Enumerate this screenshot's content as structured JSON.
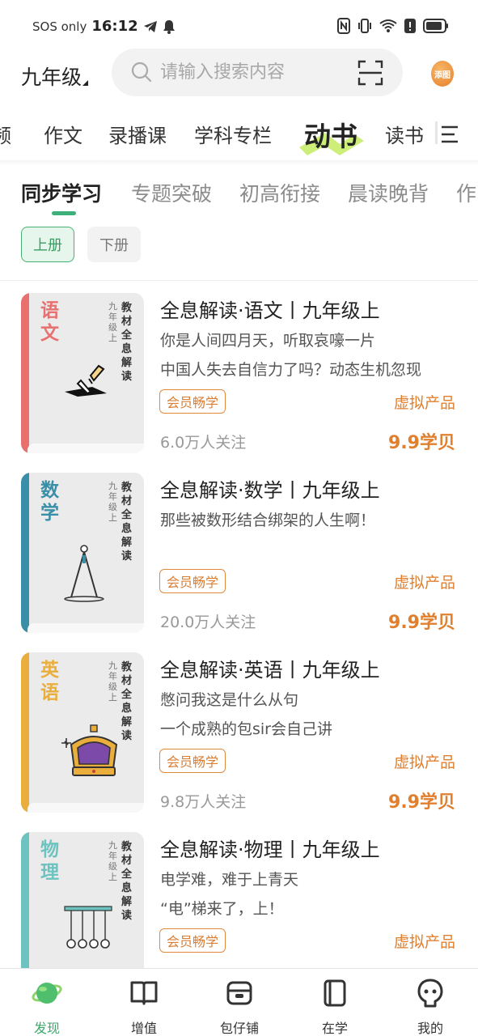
{
  "status_bar": {
    "carrier": "SOS only",
    "time": "16:12"
  },
  "header": {
    "grade": "九年级",
    "search_placeholder": "请输入搜索内容",
    "avatar_text": "添图"
  },
  "category_tabs": [
    {
      "label": "频",
      "active": false
    },
    {
      "label": "作文",
      "active": false
    },
    {
      "label": "录播课",
      "active": false
    },
    {
      "label": "学科专栏",
      "active": false
    },
    {
      "label": "动书",
      "active": true
    },
    {
      "label": "读书",
      "active": false
    }
  ],
  "sub_tabs": [
    {
      "label": "同步学习",
      "active": true
    },
    {
      "label": "专题突破",
      "active": false
    },
    {
      "label": "初高衔接",
      "active": false
    },
    {
      "label": "晨读晚背",
      "active": false
    },
    {
      "label": "作",
      "active": false
    }
  ],
  "volume": {
    "up": "上册",
    "down": "下册",
    "selected": "上册"
  },
  "cover_common": {
    "grade_vertical": "九年级上",
    "series_vertical": "教材全息解读"
  },
  "products": [
    {
      "subject": "语文",
      "subject_color": "#e8706e",
      "title": "全息解读·语文丨九年级上",
      "lines": [
        "你是人间四月天，听取哀嚎一片",
        "中国人失去自信力了吗？动态生机忽现"
      ],
      "badge": "会员畅学",
      "type": "虚拟产品",
      "followers": "6.0万人关注",
      "price": "9.9学贝",
      "icon": "pen-on-paper-icon"
    },
    {
      "subject": "数学",
      "subject_color": "#3a8fa8",
      "title": "全息解读·数学丨九年级上",
      "lines": [
        "那些被数形结合绑架的人生啊！"
      ],
      "badge": "会员畅学",
      "type": "虚拟产品",
      "followers": "20.0万人关注",
      "price": "9.9学贝",
      "icon": "compass-icon"
    },
    {
      "subject": "英语",
      "subject_color": "#e9ae3c",
      "title": "全息解读·英语丨九年级上",
      "lines": [
        "憋问我这是什么从句",
        "一个成熟的包sir会自己讲"
      ],
      "badge": "会员畅学",
      "type": "虚拟产品",
      "followers": "9.8万人关注",
      "price": "9.9学贝",
      "icon": "crown-icon"
    },
    {
      "subject": "物理",
      "subject_color": "#6cc3c0",
      "title": "全息解读·物理丨九年级上",
      "lines": [
        "电学难，难于上青天",
        "“电”梯来了，上！"
      ],
      "badge": "会员畅学",
      "type": "虚拟产品",
      "followers": "",
      "price": "",
      "icon": "newtons-cradle-icon"
    }
  ],
  "bottom_nav": [
    {
      "label": "发现",
      "active": true,
      "icon": "planet-icon"
    },
    {
      "label": "增值",
      "active": false,
      "icon": "book-icon"
    },
    {
      "label": "包仔铺",
      "active": false,
      "icon": "shop-icon"
    },
    {
      "label": "在学",
      "active": false,
      "icon": "notebook-icon"
    },
    {
      "label": "我的",
      "active": false,
      "icon": "profile-icon"
    }
  ],
  "colors": {
    "accent_green": "#3db07a",
    "price_orange": "#e07f2e"
  }
}
